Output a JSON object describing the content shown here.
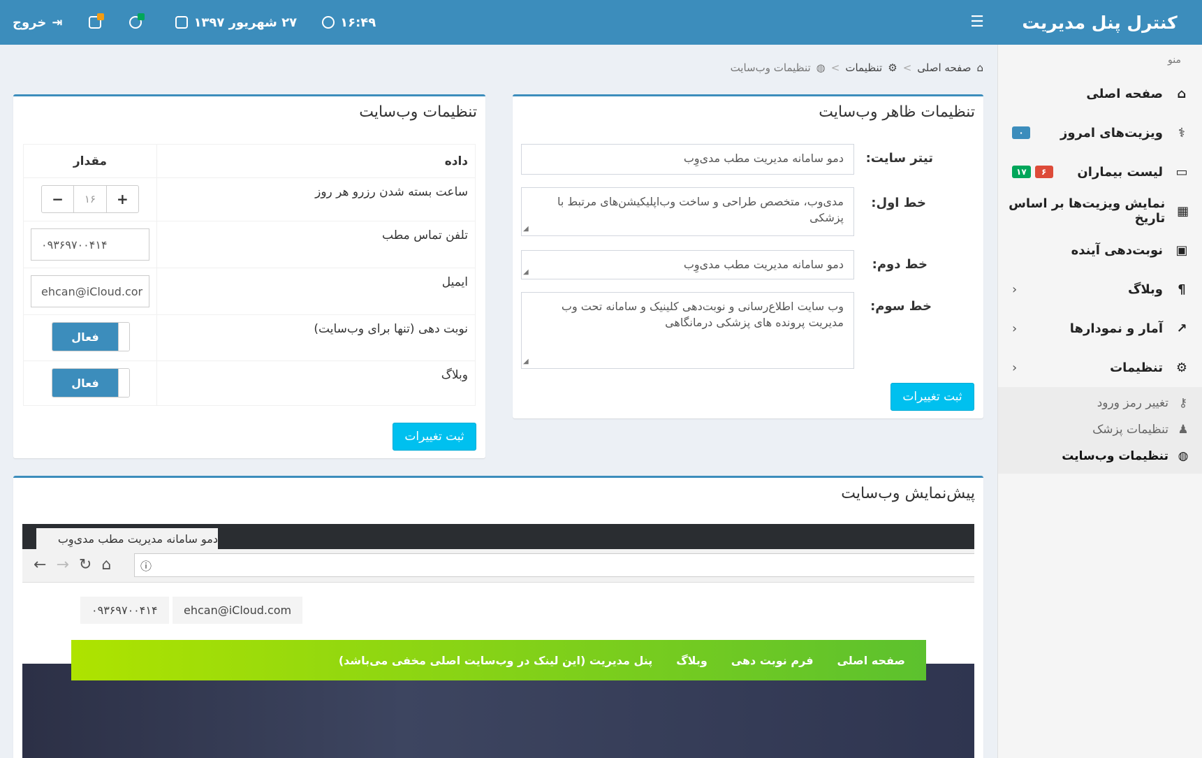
{
  "topbar": {
    "brand": "کنترل پنل مدیریت",
    "time": "۱۶:۴۹",
    "date": "۲۷ شهریور ۱۳۹۷",
    "logout": "خروج",
    "color": "#3c8dbc"
  },
  "sidebar": {
    "menu_heading": "منو",
    "items": [
      {
        "label": "صفحه اصلی",
        "icon": "home-icon"
      },
      {
        "label": "ویزیت‌های امروز",
        "icon": "stethoscope-icon",
        "badges": [
          {
            "text": "۰",
            "color": "#3c8dbc"
          }
        ]
      },
      {
        "label": "لیست بیماران",
        "icon": "folder-icon",
        "badges": [
          {
            "text": "۶",
            "color": "#dd4b39"
          },
          {
            "text": "۱۷",
            "color": "#00a65a"
          }
        ]
      },
      {
        "label": "نمایش ویزیت‌ها بر اساس تاریخ",
        "icon": "calendar-icon"
      },
      {
        "label": "نوبت‌دهی آینده",
        "icon": "calendar-plus-icon"
      },
      {
        "label": "وبلاگ",
        "icon": "paragraph-icon"
      },
      {
        "label": "آمار و نمودارها",
        "icon": "line-chart-icon"
      },
      {
        "label": "تنظیمات",
        "icon": "gear-icon"
      }
    ],
    "subitems": [
      {
        "label": "تغییر رمز ورود",
        "icon": "key-icon"
      },
      {
        "label": "تنظیمات پزشک",
        "icon": "user-doctor-icon"
      },
      {
        "label": "تنظیمات وب‌سایت",
        "icon": "globe-icon"
      }
    ]
  },
  "breadcrumb": {
    "home": "صفحه اصلی",
    "settings": "تنظیمات",
    "current": "تنظیمات وب‌سایت"
  },
  "appearance": {
    "title": "تنظیمات ظاهر وب‌سایت",
    "site_title_label": "تیتر سایت:",
    "site_title_value": "دمو سامانه مدیریت مطب مدی‌وِب",
    "line1_label": "خط اول:",
    "line1_value": "مدی‌وب، متخصص طراحی و ساخت وب‌اپلیکیشن‌های مرتبط با پزشکی",
    "line2_label": "خط دوم:",
    "line2_value": "دمو سامانه مدیریت مطب مدی‌وِب",
    "line3_label": "خط سوم:",
    "line3_value": "وب سایت اطلاع‌رسانی و نوبت‌دهی کلینیک و سامانه تحت وب مدیریت پرونده های پزشکی درمانگاهی",
    "submit": "ثبت تغییرات"
  },
  "site_settings": {
    "title": "تنظیمات وب‌سایت",
    "col_data": "داده",
    "col_value": "مقدار",
    "rows": [
      {
        "label": "ساعت بسته شدن رزرو هر روز",
        "value": "۱۶"
      },
      {
        "label": "تلفن تماس مطب",
        "value": "۰۹۳۶۹۷۰۰۴۱۴"
      },
      {
        "label": "ایمیل",
        "value": "ehcan@iCloud.cor"
      },
      {
        "label": "نوبت دهی (تنها برای وب‌سایت)",
        "value": "فعال"
      },
      {
        "label": "وبلاگ",
        "value": "فعال"
      }
    ],
    "submit": "ثبت تغییرات"
  },
  "preview": {
    "title": "پیش‌نمایش وب‌سایت",
    "tab_title": "دمو سامانه مدیریت مطب مدی‌وِب",
    "phone": "۰۹۳۶۹۷۰۰۴۱۴",
    "email": "ehcan@iCloud.com",
    "nav": [
      "صفحه اصلی",
      "فرم نوبت دهی",
      "وبلاگ",
      "پنل مدیریت (این لینک در وب‌سایت اصلی مخفی می‌باشد)"
    ]
  }
}
